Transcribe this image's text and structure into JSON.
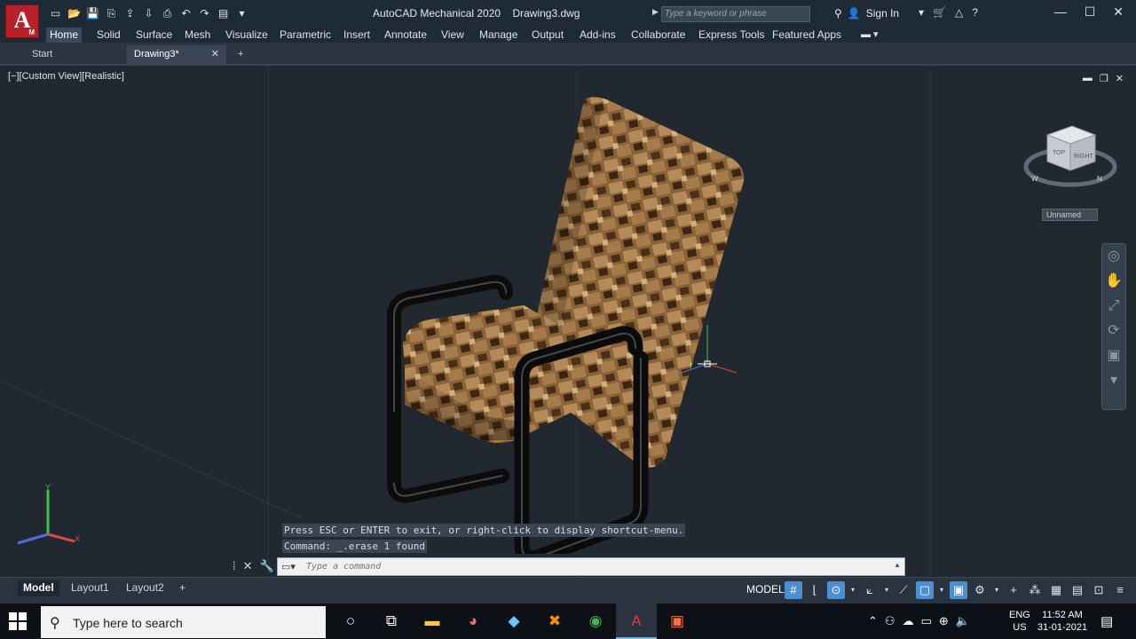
{
  "app": {
    "title": "AutoCAD Mechanical 2020",
    "document": "Drawing3.dwg",
    "logo_letter": "A",
    "logo_sub": "M"
  },
  "titlebar": {
    "search_placeholder": "Type a keyword or phrase",
    "sign_in": "Sign In",
    "quick_access_icons": [
      "new-icon",
      "open-icon",
      "save-icon",
      "save-as-icon",
      "web-open-icon",
      "web-save-icon",
      "plot-icon",
      "undo-icon",
      "redo-icon",
      "workspace-icon"
    ]
  },
  "ribbon": {
    "tabs": [
      "Home",
      "Solid",
      "Surface",
      "Mesh",
      "Visualize",
      "Parametric",
      "Insert",
      "Annotate",
      "View",
      "Manage",
      "Output",
      "Add-ins",
      "Collaborate",
      "Express Tools",
      "Featured Apps"
    ],
    "active_tab": "Home"
  },
  "filetabs": {
    "start": "Start",
    "document": "Drawing3*",
    "close_glyph": "✕",
    "add_glyph": "+"
  },
  "viewport": {
    "label": "[−][Custom View][Realistic]",
    "viewcube_top": "TOP",
    "viewcube_right": "RIGHT",
    "viewcube_unnamed": "Unnamed",
    "compass": [
      "W",
      "N"
    ],
    "ucs_labels": [
      "Y",
      "X"
    ]
  },
  "command": {
    "history": [
      "Press ESC or ENTER to exit, or right-click to display shortcut-menu.",
      "Command: _.erase 1 found"
    ],
    "input_placeholder": "Type a command"
  },
  "layouts": {
    "tabs": [
      "Model",
      "Layout1",
      "Layout2"
    ],
    "active": "Model",
    "add": "+"
  },
  "statusbar": {
    "model_label": "MODEL"
  },
  "taskbar": {
    "search_placeholder": "Type here to search",
    "lang_top": "ENG",
    "lang_bottom": "US",
    "time": "11:52 AM",
    "date": "31-01-2021"
  },
  "colors": {
    "titlebar_bg": "#1f2a37",
    "viewport_bg": "#212830",
    "logo_red": "#b8202a",
    "status_active": "#4a8fd0"
  }
}
